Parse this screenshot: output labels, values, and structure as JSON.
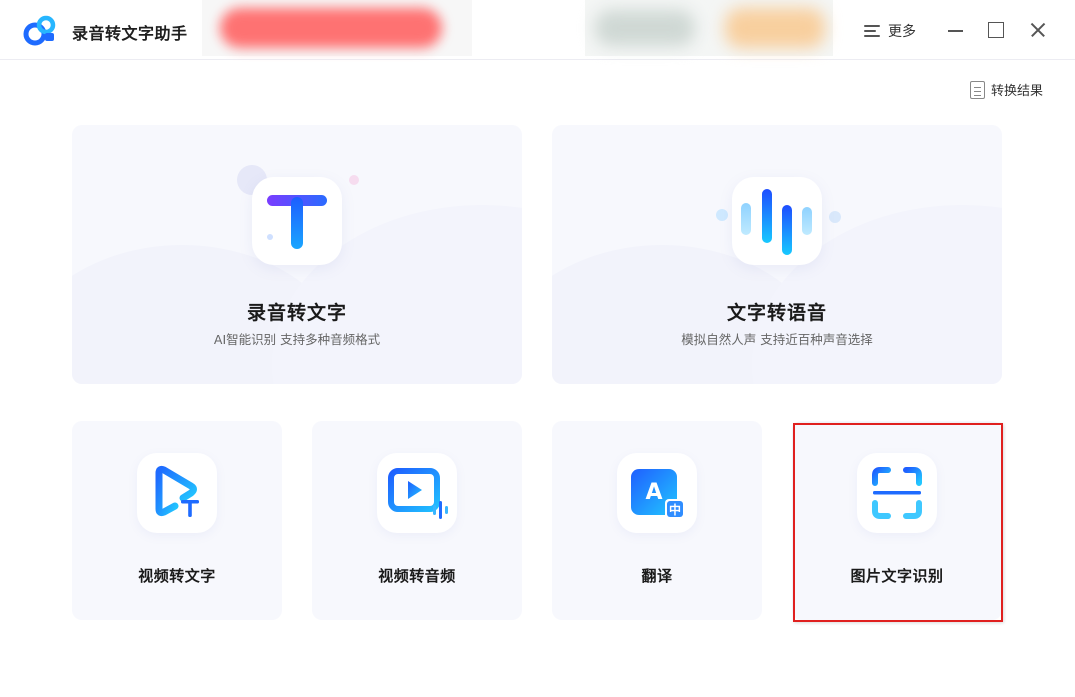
{
  "app": {
    "title": "录音转文字助手",
    "accent_color": "#1e6bff"
  },
  "titlebar": {
    "more_label": "更多",
    "more_icon": "hamburger-icon",
    "minimize_icon": "minimize-icon",
    "maximize_icon": "maximize-icon",
    "close_icon": "close-icon"
  },
  "toolbar": {
    "result_label": "转换结果",
    "result_icon": "document-icon"
  },
  "features_main": [
    {
      "title": "录音转文字",
      "subtitle": "AI智能识别 支持多种音频格式",
      "icon": "text-t-icon"
    },
    {
      "title": "文字转语音",
      "subtitle": "模拟自然人声 支持近百种声音选择",
      "icon": "voice-wave-icon"
    }
  ],
  "features_tools": [
    {
      "title": "视频转文字",
      "icon": "video-to-text-icon"
    },
    {
      "title": "视频转音频",
      "icon": "video-to-audio-icon"
    },
    {
      "title": "翻译",
      "icon": "translate-icon"
    },
    {
      "title": "图片文字识别",
      "icon": "ocr-scan-icon",
      "highlighted": true
    }
  ],
  "highlight_color": "#e0201f"
}
